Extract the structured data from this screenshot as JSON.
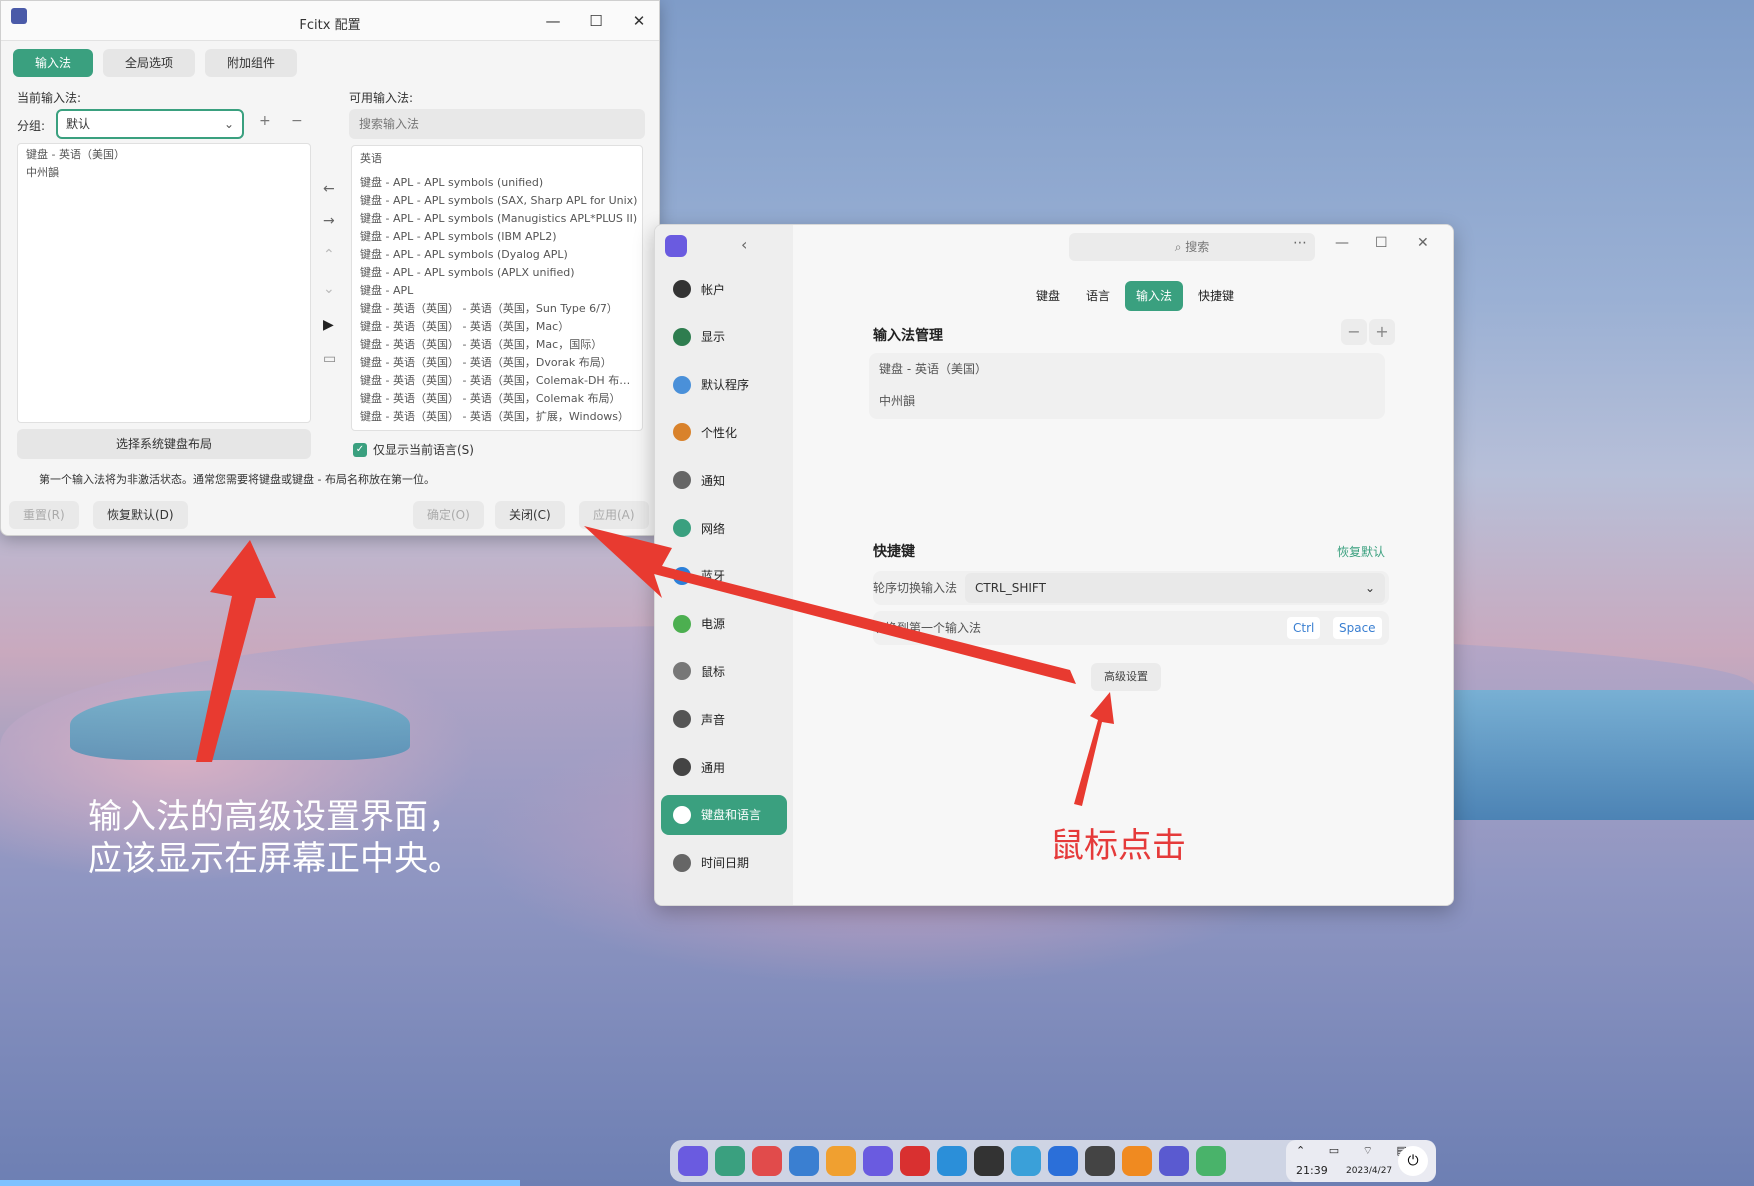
{
  "fcitx": {
    "title": "Fcitx 配置",
    "window_buttons": {
      "minimize": "—",
      "maximize": "☐",
      "close": "✕"
    },
    "tabs": [
      "输入法",
      "全局选项",
      "附加组件"
    ],
    "current_im_label": "当前输入法:",
    "available_im_label": "可用输入法:",
    "group_label": "分组:",
    "group_value": "默认",
    "add": "+",
    "remove": "−",
    "current_list": [
      "键盘 - 英语（美国）",
      "中州韻"
    ],
    "search_placeholder": "搜索输入法",
    "available_header": "英语",
    "available_list": [
      "键盘 - APL - APL symbols (unified)",
      "键盘 - APL - APL symbols (SAX, Sharp APL for Unix)",
      "键盘 - APL - APL symbols (Manugistics APL*PLUS II)",
      "键盘 - APL - APL symbols (IBM APL2)",
      "键盘 - APL - APL symbols (Dyalog APL)",
      "键盘 - APL - APL symbols (APLX unified)",
      "键盘 - APL",
      "键盘 - 英语（英国） - 英语（英国，Sun Type 6/7）",
      "键盘 - 英语（英国） - 英语（英国，Mac）",
      "键盘 - 英语（英国） - 英语（英国，Mac，国际）",
      "键盘 - 英语（英国） - 英语（英国，Dvorak 布局）",
      "键盘 - 英语（英国） - 英语（英国，Colemak-DH 布…",
      "键盘 - 英语（英国） - 英语（英国，Colemak 布局）",
      "键盘 - 英语（英国） - 英语（英国，扩展，Windows）"
    ],
    "select_layout_button": "选择系统键盘布局",
    "only_current_language": "仅显示当前语言(S)",
    "info": "第一个输入法将为非激活状态。通常您需要将键盘或键盘 - 布局名称放在第一位。",
    "buttons": {
      "reset": "重置(R)",
      "defaults": "恢复默认(D)",
      "ok": "确定(O)",
      "close": "关闭(C)",
      "apply": "应用(A)"
    }
  },
  "control_center": {
    "search_placeholder": "搜索",
    "sidebar": [
      {
        "label": "帐户",
        "sub": "帐户",
        "color": "#333333"
      },
      {
        "label": "显示",
        "color": "#2e7d4f"
      },
      {
        "label": "默认程序",
        "color": "#4a90d9"
      },
      {
        "label": "个性化",
        "color": "#d9822b"
      },
      {
        "label": "通知",
        "color": "#666666"
      },
      {
        "label": "网络",
        "color": "#3aa07f"
      },
      {
        "label": "蓝牙",
        "color": "#2b7fd9"
      },
      {
        "label": "电源",
        "color": "#4caf50"
      },
      {
        "label": "鼠标",
        "color": "#777777"
      },
      {
        "label": "声音",
        "color": "#555555"
      },
      {
        "label": "通用",
        "color": "#444444"
      },
      {
        "label": "键盘和语言",
        "color": "#ffffff"
      },
      {
        "label": "时间日期",
        "color": "#666666"
      }
    ],
    "tabs": [
      "键盘",
      "语言",
      "输入法",
      "快捷键"
    ],
    "im_manage_title": "输入法管理",
    "im_list": [
      "键盘 - 英语（美国）",
      "中州韻"
    ],
    "shortcut_title": "快捷键",
    "restore_default": "恢复默认",
    "cycle_label": "轮序切换输入法",
    "cycle_value": "CTRL_SHIFT",
    "switch_first_label": "切换到第一个输入法",
    "keys": [
      "Ctrl",
      "Space"
    ],
    "advanced_button": "高级设置"
  },
  "dock": {
    "icon_colors": [
      "#6a5be0",
      "#3aa07f",
      "#e14b4b",
      "#3a7fd1",
      "#f0a030",
      "#6a5be0",
      "#d93030",
      "#2b8fd9",
      "#333333",
      "#3aa0d9",
      "#2b6fd9",
      "#444444",
      "#f08a20",
      "#5a5ad0",
      "#49b36a"
    ],
    "time": "21:39",
    "date": "2023/4/27"
  },
  "annotations": {
    "left_line1": "输入法的高级设置界面，",
    "left_line2": "应该显示在屏幕正中央。",
    "right": "鼠标点击",
    "arrow_color": "#e83a30"
  }
}
